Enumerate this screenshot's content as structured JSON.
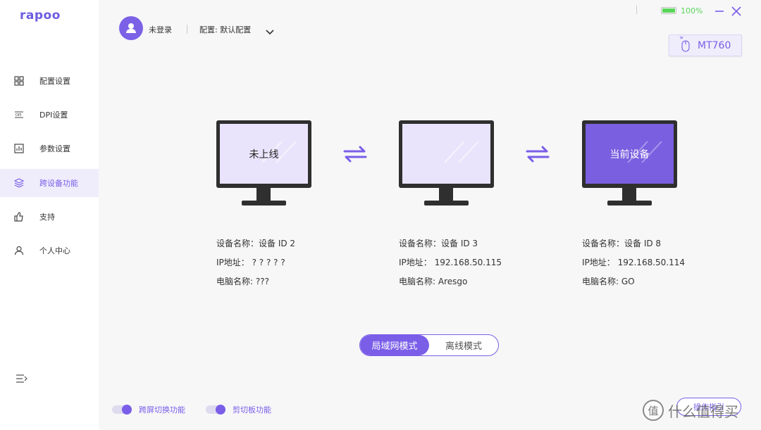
{
  "app": {
    "logo": "rapoo",
    "accent": "#7a5ee8"
  },
  "sidebar": {
    "items": [
      {
        "label": "配置设置",
        "icon": "grid-icon",
        "active": false
      },
      {
        "label": "DPI设置",
        "icon": "dpi-icon",
        "active": false
      },
      {
        "label": "参数设置",
        "icon": "chart-icon",
        "active": false
      },
      {
        "label": "跨设备功能",
        "icon": "layers-icon",
        "active": true
      },
      {
        "label": "支持",
        "icon": "thumbs-up-icon",
        "active": false
      },
      {
        "label": "个人中心",
        "icon": "user-icon",
        "active": false
      }
    ]
  },
  "header": {
    "login": "未登录",
    "config": "配置: 默认配置"
  },
  "status": {
    "battery_text": "100%",
    "battery_level": 1.0,
    "battery_color": "#5ad65a"
  },
  "device": {
    "name": "MT760"
  },
  "monitors": [
    {
      "screen_text": "未上线",
      "current": false,
      "name": "设备名称：设备 ID 2",
      "ip": "IP地址：  ? ? ? ? ?",
      "pc": "电脑名称: ???"
    },
    {
      "screen_text": "",
      "current": false,
      "name": "设备名称：设备 ID 3",
      "ip": "IP地址：  192.168.50.115",
      "pc": "电脑名称: Aresgo"
    },
    {
      "screen_text": "当前设备",
      "current": true,
      "name": "设备名称：设备 ID 8",
      "ip": "IP地址：  192.168.50.114",
      "pc": "电脑名称: GO"
    }
  ],
  "modes": {
    "lan": "局域网模式",
    "offline": "离线模式",
    "selected": "lan"
  },
  "toggles": {
    "cross_screen": "跨屏切换功能",
    "clipboard": "剪切板功能"
  },
  "guide_button": "操作指引",
  "watermark": "什么值得买",
  "watermark_badge": "值"
}
